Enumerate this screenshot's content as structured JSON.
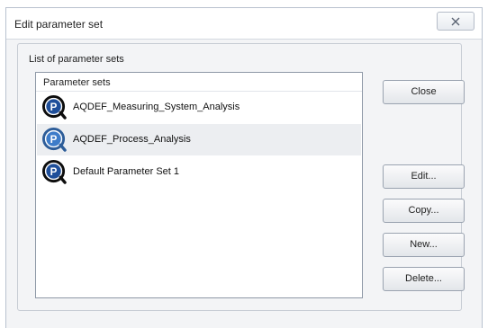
{
  "window": {
    "title": "Edit parameter set"
  },
  "group": {
    "label": "List of parameter sets"
  },
  "list": {
    "header": "Parameter sets",
    "items": [
      {
        "label": "AQDEF_Measuring_System_Analysis",
        "icon": "parameter-set-icon",
        "selected": false
      },
      {
        "label": "AQDEF_Process_Analysis",
        "icon": "parameter-set-icon",
        "selected": true
      },
      {
        "label": "Default Parameter Set 1",
        "icon": "parameter-set-icon",
        "selected": false
      }
    ]
  },
  "buttons": {
    "close": "Close",
    "edit": "Edit...",
    "copy": "Copy...",
    "new": "New...",
    "delete": "Delete..."
  },
  "colors": {
    "icon_ring": "#0d0d0d",
    "icon_fill_normal": "#1f4f9a",
    "icon_fill_selected": "#3d7cc9",
    "selection_bg": "#eceef1"
  }
}
